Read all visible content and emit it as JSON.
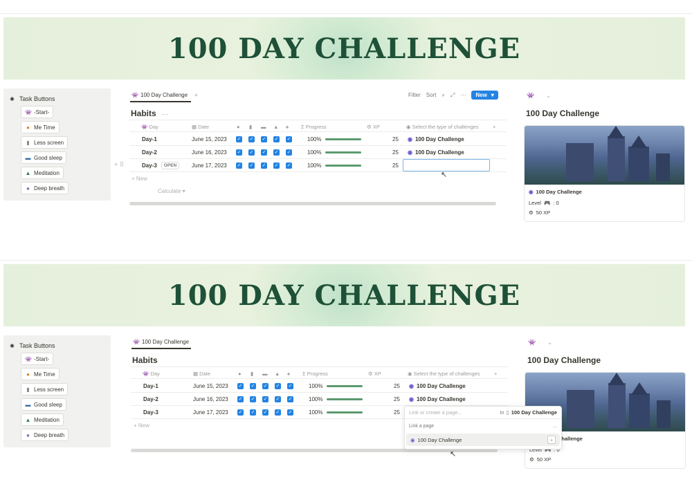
{
  "banner_title": "100 DAY CHALLENGE",
  "task_buttons": {
    "title": "Task Buttons",
    "items": [
      {
        "label": "-Start-",
        "icon": "invader-icon"
      },
      {
        "label": "Me Time",
        "icon": "person-icon"
      },
      {
        "label": "Less screen",
        "icon": "phone-icon"
      },
      {
        "label": "Good sleep",
        "icon": "bed-icon"
      },
      {
        "label": "Meditation",
        "icon": "mountain-icon"
      },
      {
        "label": "Deep breath",
        "icon": "lungs-icon"
      }
    ]
  },
  "view_tab": "100 Day Challenge",
  "toolbar": {
    "filter": "Filter",
    "sort": "Sort",
    "new": "New"
  },
  "db_title": "Habits",
  "columns": {
    "day": "Day",
    "date": "Date",
    "progress": "Progress",
    "xp": "XP",
    "challenge": "Select the type of challenges"
  },
  "rows": [
    {
      "day": "Day-1",
      "date": "June 15, 2023",
      "progress": "100%",
      "progress_value": 1.0,
      "xp": "25",
      "challenge": "100 Day Challenge"
    },
    {
      "day": "Day-2",
      "date": "June 16, 2023",
      "progress": "100%",
      "progress_value": 1.0,
      "xp": "25",
      "challenge": "100 Day Challenge"
    },
    {
      "day": "Day-3",
      "date": "June 17, 2023",
      "progress": "100%",
      "progress_value": 1.0,
      "xp": "25",
      "challenge": "100 Day Challenge"
    }
  ],
  "open_label": "OPEN",
  "new_row": "+ New",
  "calculate": "Calculate",
  "side": {
    "title": "100 Day Challenge",
    "link": "100 Day Challenge",
    "level": "Level",
    "level_value": ": 0",
    "xp": "50 XP"
  },
  "popup": {
    "placeholder": "Link or create a page...",
    "in": "In",
    "in_page": "100 Day Challenge",
    "section": "Link a page",
    "option": "100 Day Challenge",
    "more": "..."
  },
  "colors": {
    "accent": "#2383e2",
    "banner_text": "#1e5137",
    "progress": "#5b9a6d"
  }
}
